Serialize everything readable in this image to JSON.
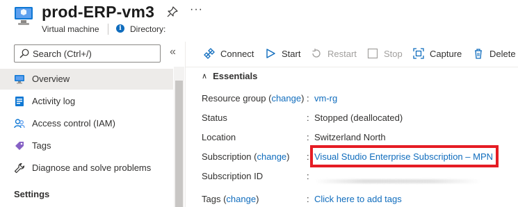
{
  "header": {
    "title": "prod-ERP-vm3",
    "subtitle": "Virtual machine",
    "directory_label": "Directory:",
    "more_glyph": "···",
    "info_glyph": "i"
  },
  "sidebar": {
    "search_placeholder": "Search (Ctrl+/)",
    "collapse_glyph": "«",
    "items": [
      {
        "label": "Overview",
        "icon": "monitor-icon",
        "active": true
      },
      {
        "label": "Activity log",
        "icon": "activity-log-icon"
      },
      {
        "label": "Access control (IAM)",
        "icon": "people-icon"
      },
      {
        "label": "Tags",
        "icon": "tag-icon"
      },
      {
        "label": "Diagnose and solve problems",
        "icon": "wrench-icon"
      }
    ],
    "section_settings": "Settings"
  },
  "toolbar": {
    "connect": "Connect",
    "start": "Start",
    "restart": "Restart",
    "stop": "Stop",
    "capture": "Capture",
    "delete": "Delete"
  },
  "essentials": {
    "heading": "Essentials",
    "chevron": "∧",
    "change_label": "change",
    "rows": {
      "resource_group": {
        "label": "Resource group",
        "value": "vm-rg"
      },
      "status": {
        "label": "Status",
        "value": "Stopped (deallocated)"
      },
      "location": {
        "label": "Location",
        "value": "Switzerland North"
      },
      "subscription": {
        "label": "Subscription",
        "value": "Visual Studio Enterprise Subscription – MPN"
      },
      "subscription_id": {
        "label": "Subscription ID",
        "value": ""
      },
      "tags": {
        "label": "Tags",
        "value": "Click here to add tags"
      }
    }
  },
  "colors": {
    "accent": "#0f6cbd",
    "highlight_border": "#e51c24",
    "active_nav_bg": "#edebe9"
  }
}
